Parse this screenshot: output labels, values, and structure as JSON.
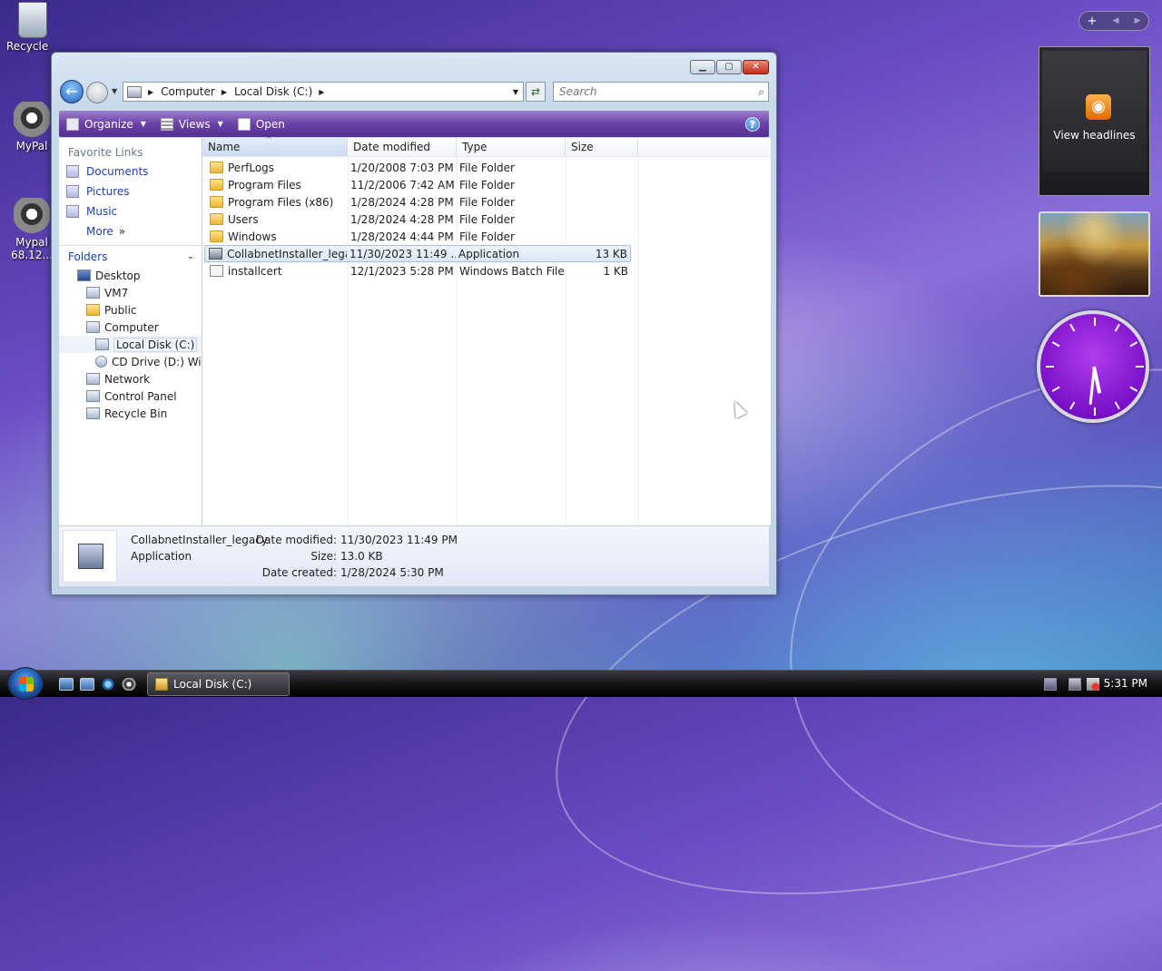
{
  "desktop": {
    "icons": [
      {
        "label": "Recycle Bin"
      },
      {
        "label": "MyPal"
      },
      {
        "label": "Mypal\n68.12..."
      }
    ]
  },
  "sidebar": {
    "rss_label": "View headlines"
  },
  "window": {
    "address": {
      "crumbs": [
        "Computer",
        "Local Disk (C:)"
      ]
    },
    "search": {
      "placeholder": "Search"
    },
    "toolbar": {
      "organize": "Organize",
      "views": "Views",
      "open": "Open",
      "help": "?"
    },
    "navpane": {
      "favorite_links_title": "Favorite Links",
      "favorites": [
        "Documents",
        "Pictures",
        "Music",
        "More"
      ],
      "more_chevron": "»",
      "folders_title": "Folders",
      "tree": [
        {
          "label": "Desktop"
        },
        {
          "label": "VM7"
        },
        {
          "label": "Public"
        },
        {
          "label": "Computer"
        },
        {
          "label": "Local Disk (C:)"
        },
        {
          "label": "CD Drive (D:) Wine"
        },
        {
          "label": "Network"
        },
        {
          "label": "Control Panel"
        },
        {
          "label": "Recycle Bin"
        }
      ]
    },
    "columns": [
      "Name",
      "Date modified",
      "Type",
      "Size"
    ],
    "files": [
      {
        "name": "PerfLogs",
        "date": "1/20/2008 7:03 PM",
        "type": "File Folder",
        "size": "",
        "icon": "folder-icon"
      },
      {
        "name": "Program Files",
        "date": "11/2/2006 7:42 AM",
        "type": "File Folder",
        "size": "",
        "icon": "folder-icon"
      },
      {
        "name": "Program Files (x86)",
        "date": "1/28/2024 4:28 PM",
        "type": "File Folder",
        "size": "",
        "icon": "folder-icon"
      },
      {
        "name": "Users",
        "date": "1/28/2024 4:28 PM",
        "type": "File Folder",
        "size": "",
        "icon": "folder-icon"
      },
      {
        "name": "Windows",
        "date": "1/28/2024 4:44 PM",
        "type": "File Folder",
        "size": "",
        "icon": "folder-icon"
      },
      {
        "name": "CollabnetInstaller_lega...",
        "date": "11/30/2023 11:49 ...",
        "type": "Application",
        "size": "13 KB",
        "icon": "application-icon"
      },
      {
        "name": "installcert",
        "date": "12/1/2023 5:28 PM",
        "type": "Windows Batch File",
        "size": "1 KB",
        "icon": "batch-file-icon"
      }
    ],
    "details": {
      "name": "CollabnetInstaller_legacy",
      "kind": "Application",
      "date_modified_label": "Date modified:",
      "date_modified": "11/30/2023 11:49 PM",
      "size_label": "Size:",
      "size": "13.0 KB",
      "date_created_label": "Date created:",
      "date_created": "1/28/2024 5:30 PM"
    }
  },
  "taskbar": {
    "task_label": "Local Disk (C:)",
    "clock": "5:31 PM"
  }
}
